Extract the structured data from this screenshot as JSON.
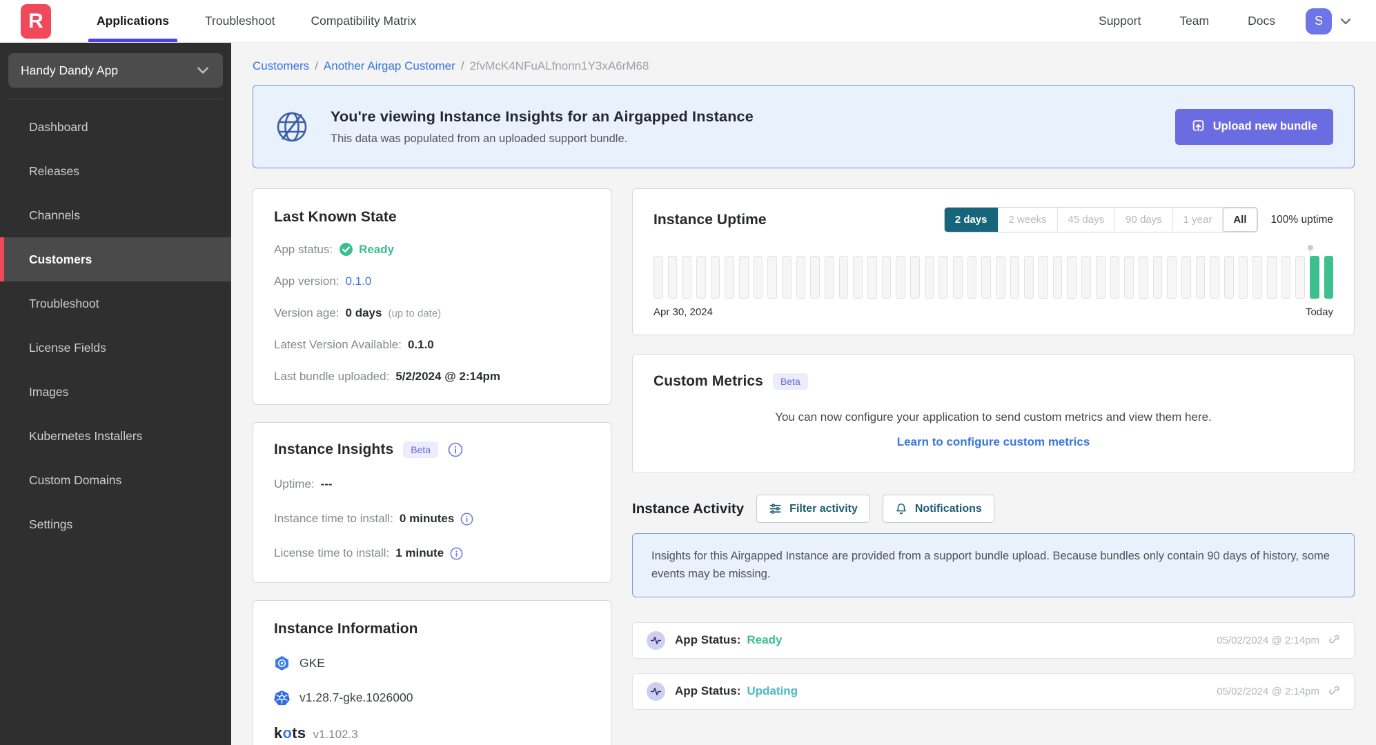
{
  "colors": {
    "brand_red": "#f2485c",
    "accent_indigo": "#6b6ce2",
    "nav_underline": "#4743e8",
    "link_blue": "#3777de",
    "success_green": "#3cbe8e",
    "updating_teal": "#4db8c6",
    "range_active_teal": "#17657a",
    "badge_purple": "#646ad8",
    "bar_green": "#3cc08e"
  },
  "topnav": {
    "logo_letter": "R",
    "tabs": [
      {
        "label": "Applications",
        "active": true
      },
      {
        "label": "Troubleshoot",
        "active": false
      },
      {
        "label": "Compatibility Matrix",
        "active": false
      }
    ],
    "links": [
      {
        "label": "Support"
      },
      {
        "label": "Team"
      },
      {
        "label": "Docs"
      }
    ],
    "avatar_letter": "S"
  },
  "sidebar": {
    "app_selector": "Handy Dandy App",
    "items": [
      {
        "label": "Dashboard",
        "active": false
      },
      {
        "label": "Releases",
        "active": false
      },
      {
        "label": "Channels",
        "active": false
      },
      {
        "label": "Customers",
        "active": true
      },
      {
        "label": "Troubleshoot",
        "active": false
      },
      {
        "label": "License Fields",
        "active": false
      },
      {
        "label": "Images",
        "active": false
      },
      {
        "label": "Kubernetes Installers",
        "active": false
      },
      {
        "label": "Custom Domains",
        "active": false
      },
      {
        "label": "Settings",
        "active": false
      }
    ]
  },
  "breadcrumb": {
    "separator": "/",
    "segments": [
      "Customers",
      "Another Airgap Customer",
      "2fvMcK4NFuALfnonn1Y3xA6rM68"
    ]
  },
  "banner": {
    "title": "You're viewing Instance Insights for an Airgapped Instance",
    "subtitle": "This data was populated from an uploaded support bundle.",
    "button_label": "Upload new bundle"
  },
  "last_known_state": {
    "title": "Last Known State",
    "app_status_label": "App status:",
    "app_status_value": "Ready",
    "app_version_label": "App version:",
    "app_version_value": "0.1.0",
    "version_age_label": "Version age:",
    "version_age_value": "0 days",
    "version_age_note": "(up to date)",
    "latest_version_label": "Latest Version Available:",
    "latest_version_value": "0.1.0",
    "last_bundle_label": "Last bundle uploaded:",
    "last_bundle_value": "5/2/2024 @ 2:14pm"
  },
  "instance_insights": {
    "title": "Instance Insights",
    "beta": "Beta",
    "uptime_label": "Uptime:",
    "uptime_value": "---",
    "tti_label": "Instance time to install:",
    "tti_value": "0 minutes",
    "ltti_label": "License time to install:",
    "ltti_value": "1 minute"
  },
  "instance_information": {
    "title": "Instance Information",
    "distribution": "GKE",
    "k8s_version": "v1.28.7-gke.1026000",
    "kots_parts": [
      "k",
      "o",
      "ts"
    ],
    "kots_version": "v1.102.3"
  },
  "instance_uptime": {
    "title": "Instance Uptime",
    "ranges": [
      "2 days",
      "2 weeks",
      "45 days",
      "90 days",
      "1 year",
      "All"
    ],
    "active_range": "2 days",
    "uptime_text": "100% uptime",
    "start_label": "Apr 30, 2024",
    "end_label": "Today",
    "bars": {
      "total": 48,
      "up_last": 2
    }
  },
  "custom_metrics": {
    "title": "Custom Metrics",
    "beta": "Beta",
    "description": "You can now configure your application to send custom metrics and view them here.",
    "link": "Learn to configure custom metrics"
  },
  "instance_activity": {
    "title": "Instance Activity",
    "filter_button": "Filter activity",
    "notifications_button": "Notifications",
    "notice": "Insights for this Airgapped Instance are provided from a support bundle upload. Because bundles only contain 90 days of history, some events may be missing.",
    "events": [
      {
        "label": "App Status:",
        "status": "Ready",
        "status_color": "#3cbe8e",
        "timestamp": "05/02/2024 @ 2:14pm"
      },
      {
        "label": "App Status:",
        "status": "Updating",
        "status_color": "#4db8c6",
        "timestamp": "05/02/2024 @ 2:14pm"
      }
    ]
  }
}
